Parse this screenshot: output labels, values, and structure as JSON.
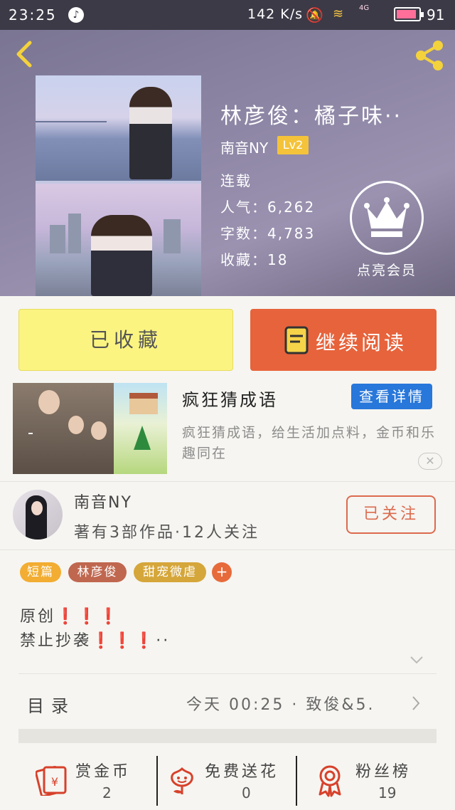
{
  "status_bar": {
    "time": "23:25",
    "network_speed": "142 K/s",
    "battery_percent": "91",
    "battery_level": 0.91,
    "signal_label": "4G"
  },
  "book": {
    "title": "林彦俊：橘子味··",
    "author": "南音NY",
    "level": "Lv2",
    "status": "连载",
    "popularity": "人气：6,262",
    "word_count": "字数：4,783",
    "favorites": "收藏：18"
  },
  "vip": {
    "label": "点亮会员"
  },
  "actions": {
    "collected_label": "已收藏",
    "continue_label": "继续阅读"
  },
  "ad": {
    "title": "疯狂猜成语",
    "detail_button": "查看详情",
    "description": "疯狂猜成语，给生活加点料，金币和乐趣同在",
    "close": "✕"
  },
  "author_section": {
    "name": "南音NY",
    "stats": "著有3部作品·12人关注",
    "follow_label": "已关注"
  },
  "tags": [
    {
      "label": "短篇",
      "color": "#f2ad32"
    },
    {
      "label": "林彦俊",
      "color": "#c0674f"
    },
    {
      "label": "甜宠微虐",
      "color": "#d5a63a"
    }
  ],
  "tag_add": "+",
  "description": {
    "line1": "原创",
    "line1_marks": "❗❗❗",
    "line2": "禁止抄袭",
    "line2_marks": "❗❗❗",
    "line2_tail": "··"
  },
  "catalog": {
    "label": "目录",
    "latest": "今天 00:25 · 致俊&5."
  },
  "bottom_bar": {
    "reward": {
      "label": "赏金币",
      "count": "2",
      "icon": "red-envelope-icon"
    },
    "flower": {
      "label": "免费送花",
      "count": "0",
      "icon": "flower-icon"
    },
    "fans": {
      "label": "粉丝榜",
      "count": "19",
      "icon": "medal-icon"
    }
  },
  "colors": {
    "accent_orange": "#e7633b",
    "collected_yellow": "#fbf481",
    "detail_blue": "#2877da",
    "follow_red": "#dc6a4e",
    "icon_red": "#d7412b"
  }
}
